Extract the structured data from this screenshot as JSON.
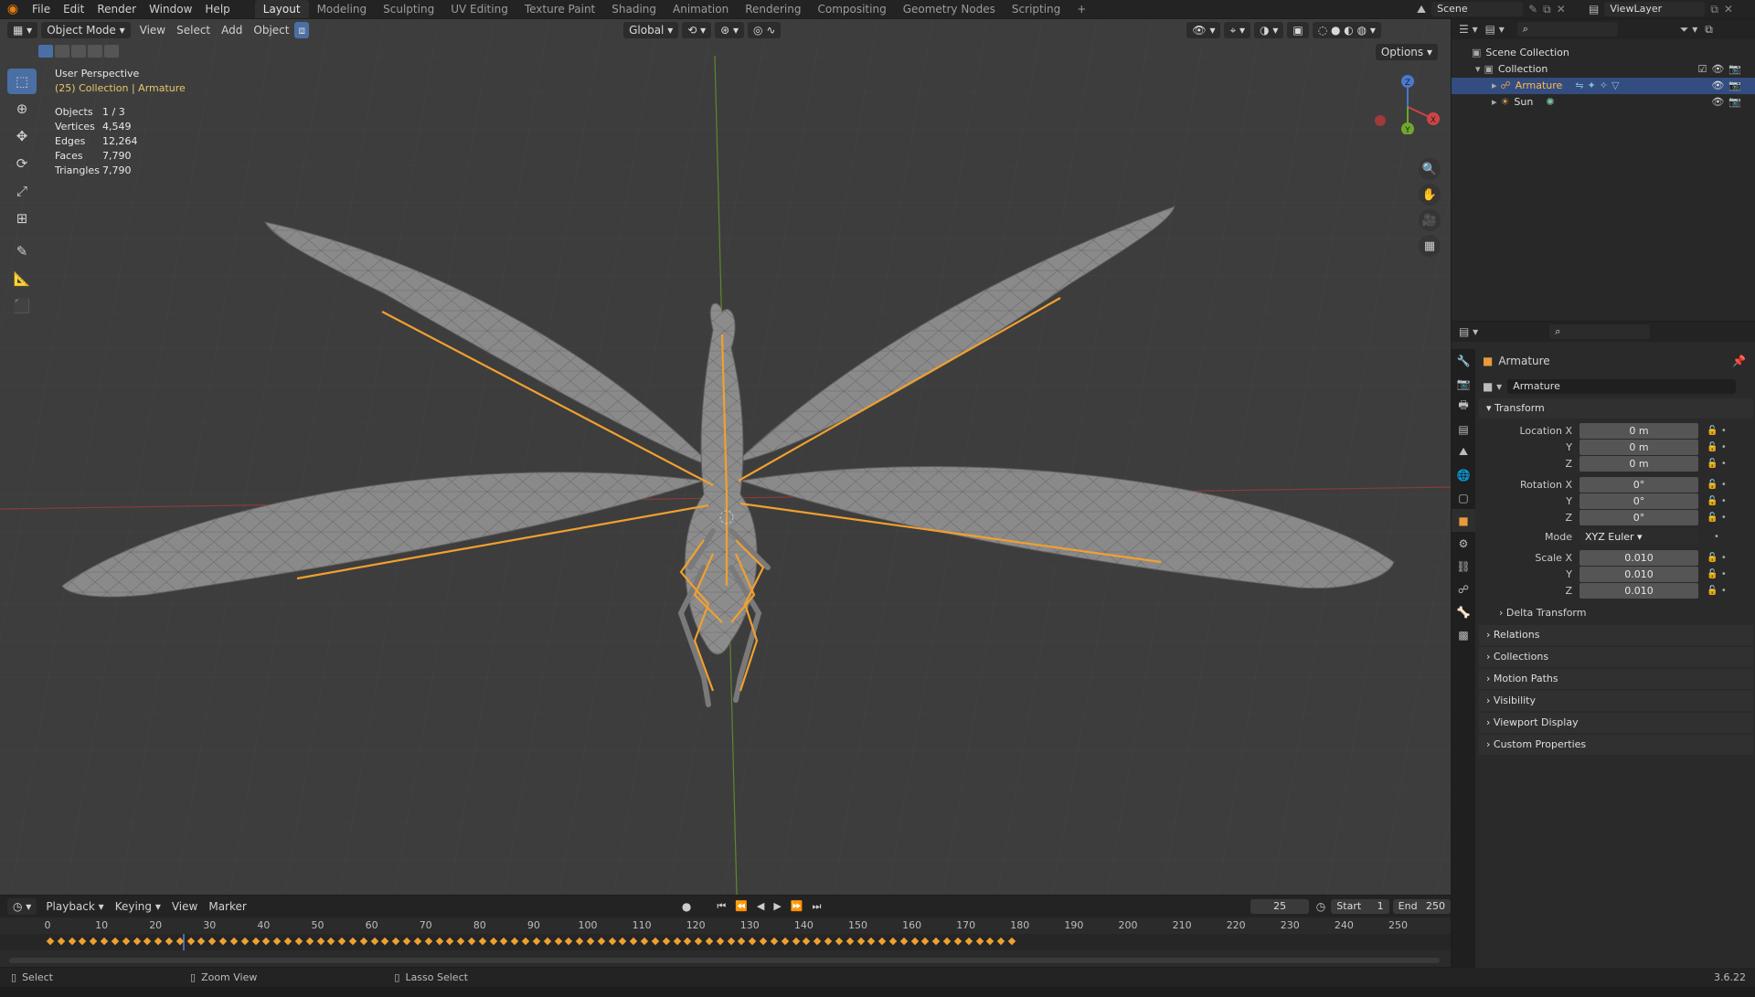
{
  "topbar": {
    "menus": [
      "File",
      "Edit",
      "Render",
      "Window",
      "Help"
    ],
    "workspaces": [
      "Layout",
      "Modeling",
      "Sculpting",
      "UV Editing",
      "Texture Paint",
      "Shading",
      "Animation",
      "Rendering",
      "Compositing",
      "Geometry Nodes",
      "Scripting"
    ],
    "active_workspace": "Layout",
    "add_workspace": "+",
    "scene": "Scene",
    "view_layer": "ViewLayer"
  },
  "viewport": {
    "mode": "Object Mode",
    "menus": [
      "View",
      "Select",
      "Add",
      "Object"
    ],
    "orientation": "Global",
    "options": "Options",
    "perspective": "User Perspective",
    "collection_path": "(25) Collection | Armature",
    "stats": [
      {
        "k": "Objects",
        "v": "1 / 3"
      },
      {
        "k": "Vertices",
        "v": "4,549"
      },
      {
        "k": "Edges",
        "v": "12,264"
      },
      {
        "k": "Faces",
        "v": "7,790"
      },
      {
        "k": "Triangles",
        "v": "7,790"
      }
    ],
    "gizmo": {
      "x": "X",
      "y": "Y",
      "z": "Z"
    }
  },
  "outliner": {
    "items": [
      {
        "label": "Scene Collection"
      },
      {
        "label": "Collection"
      },
      {
        "label": "Armature"
      },
      {
        "label": "Sun"
      }
    ]
  },
  "properties": {
    "object_name": "Armature",
    "data_name": "Armature",
    "transform_label": "Transform",
    "location_label": "Location X",
    "rotation_label": "Rotation X",
    "scale_label": "Scale X",
    "y_label": "Y",
    "z_label": "Z",
    "location": [
      "0 m",
      "0 m",
      "0 m"
    ],
    "rotation": [
      "0°",
      "0°",
      "0°"
    ],
    "mode_label": "Mode",
    "mode_value": "XYZ Euler",
    "scale": [
      "0.010",
      "0.010",
      "0.010"
    ],
    "sections": [
      "Delta Transform",
      "Relations",
      "Collections",
      "Motion Paths",
      "Visibility",
      "Viewport Display",
      "Custom Properties"
    ]
  },
  "timeline": {
    "menus": [
      "Playback",
      "Keying",
      "View",
      "Marker"
    ],
    "current_frame": "25",
    "start_label": "Start",
    "start": "1",
    "end_label": "End",
    "end": "250",
    "ticks": [
      "0",
      "10",
      "20",
      "30",
      "40",
      "50",
      "60",
      "70",
      "80",
      "90",
      "100",
      "110",
      "120",
      "130",
      "140",
      "150",
      "160",
      "170",
      "180",
      "190",
      "200",
      "210",
      "220",
      "230",
      "240",
      "250"
    ],
    "playhead": "25"
  },
  "statusbar": {
    "select": "Select",
    "zoom": "Zoom View",
    "lasso": "Lasso Select",
    "version": "3.6.22"
  },
  "colors": {
    "accent": "#4a6fa5",
    "bone": "#f0a030",
    "selection": "#334d80"
  }
}
